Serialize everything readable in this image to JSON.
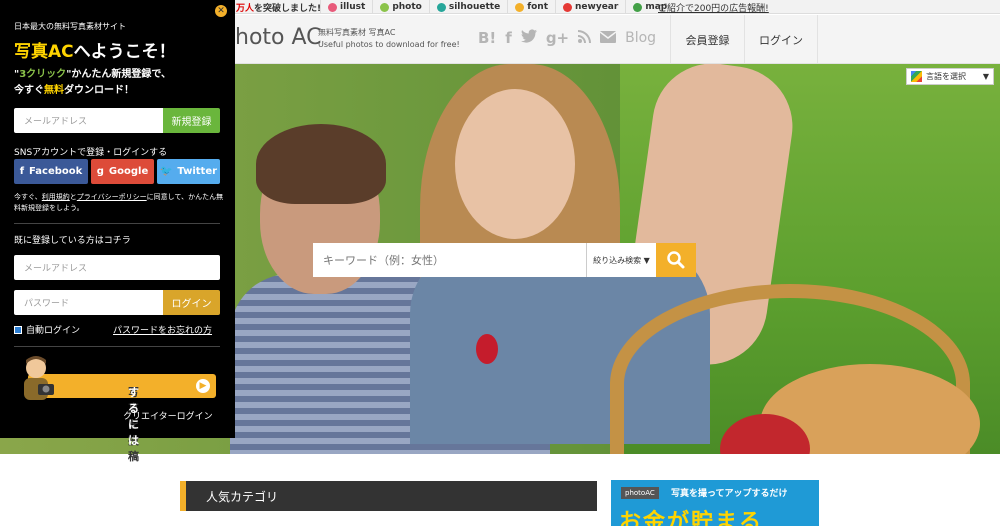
{
  "topbar": {
    "users_prefix": "",
    "users_highlight": "万人",
    "users_suffix": "を突破しました!",
    "links": [
      {
        "label": "illust",
        "color": "#e85a7a",
        "icon": "illust-icon"
      },
      {
        "label": "photo",
        "color": "#8bc34a",
        "icon": "photo-icon"
      },
      {
        "label": "silhouette",
        "color": "#26a69a",
        "icon": "silhouette-icon"
      },
      {
        "label": "font",
        "color": "#f3b02a",
        "icon": "font-icon"
      },
      {
        "label": "newyear",
        "color": "#e53935",
        "icon": "newyear-icon"
      },
      {
        "label": "map",
        "color": "#43a047",
        "icon": "map-icon"
      }
    ],
    "ad_link": "ご紹介で200円の広告報酬!"
  },
  "header": {
    "logo": "hoto AC",
    "sub1": "無料写真素材  写真AC",
    "sub2": "Useful photos to download for free!",
    "blog": "Blog",
    "nav_register": "会員登録",
    "nav_login": "ログイン"
  },
  "hero": {
    "search_placeholder": "キーワード（例：女性）",
    "filter_label": "絞り込み検索 ▼",
    "lang_label": "言語を選択"
  },
  "panel": {
    "site_note": "日本最大の無料写真素材サイト",
    "welcome_highlight": "写真AC",
    "welcome_rest": "へようこそ！",
    "promo_q1": "\"",
    "promo_3click": "3クリック",
    "promo_q2": "\"かんたん新規登録で、",
    "promo_line2a": "今すぐ",
    "promo_free": "無料",
    "promo_line2b": "ダウンロード！",
    "email_placeholder": "メールアドレス",
    "register_button": "新規登録",
    "sns_label": "SNSアカウントで登録・ログインする",
    "facebook": "Facebook",
    "google": "Google",
    "twitter": "Twitter",
    "terms_a": "今すぐ、",
    "terms_link1": "利用規約",
    "terms_b": "と",
    "terms_link2": "プライバシーポリシー",
    "terms_c": "に同意して、かんたん無料新規登録をしよう。",
    "already": "既に登録している方はコチラ",
    "login_email_placeholder": "メールアドレス",
    "password_placeholder": "パスワード",
    "login_button": "ログイン",
    "auto_login": "自動ログイン",
    "forgot": "パスワードをお忘れの方",
    "post_a": "写真を投稿",
    "post_b": "するには",
    "creator": "クリエイターログイン"
  },
  "content": {
    "category_title": "人気カテゴリ",
    "banner_tag": "photoAC",
    "banner_msg": "写真を撮ってアップするだけ",
    "banner_big": "お金が貯まる"
  }
}
